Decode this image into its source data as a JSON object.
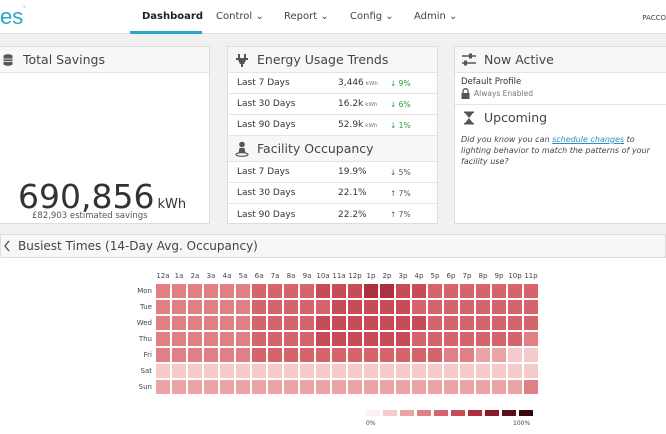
{
  "nav": {
    "logo": "es",
    "logo_mark": "°",
    "items": [
      {
        "label": "Dashboard",
        "active": true
      },
      {
        "label": "Control ⌄"
      },
      {
        "label": "Report ⌄"
      },
      {
        "label": "Config ⌄"
      },
      {
        "label": "Admin ⌄"
      }
    ],
    "user": "PACCO"
  },
  "savings": {
    "title": "Total Savings",
    "value": "690,856",
    "unit": "kWh",
    "subtext": "£82,903 estimated savings"
  },
  "energy": {
    "title": "Energy Usage Trends",
    "rows": [
      {
        "label": "Last 7 Days",
        "value": "3,446",
        "unit": "kWh",
        "change": "↓ 9%"
      },
      {
        "label": "Last 30 Days",
        "value": "16.2k",
        "unit": "kWh",
        "change": "↓ 6%"
      },
      {
        "label": "Last 90 Days",
        "value": "52.9k",
        "unit": "kWh",
        "change": "↓ 1%"
      }
    ]
  },
  "occupancy": {
    "title": "Facility Occupancy",
    "rows": [
      {
        "label": "Last 7 Days",
        "value": "19.9%",
        "change": "↓ 5%"
      },
      {
        "label": "Last 30 Days",
        "value": "22.1%",
        "change": "↑ 7%"
      },
      {
        "label": "Last 90 Days",
        "value": "22.2%",
        "change": "↑ 7%"
      }
    ]
  },
  "now_active": {
    "title": "Now Active",
    "profile": "Default Profile",
    "status": "Always Enabled"
  },
  "upcoming": {
    "title": "Upcoming",
    "tip_before": "Did you know you can ",
    "tip_link": "schedule changes",
    "tip_after": " to lighting behavior to match the patterns of your facility use?"
  },
  "busiest": {
    "title": "Busiest Times (14-Day Avg. Occupancy)",
    "hours": [
      "12a",
      "1a",
      "2a",
      "3a",
      "4a",
      "5a",
      "6a",
      "7a",
      "8a",
      "9a",
      "10a",
      "11a",
      "12p",
      "1p",
      "2p",
      "3p",
      "4p",
      "5p",
      "6p",
      "7p",
      "8p",
      "9p",
      "10p",
      "11p"
    ],
    "days": [
      "Mon",
      "Tue",
      "Wed",
      "Thu",
      "Fri",
      "Sat",
      "Sun"
    ],
    "levels": [
      [
        3,
        3,
        3,
        3,
        3,
        3,
        4,
        4,
        4,
        4,
        5,
        5,
        5,
        6,
        6,
        5,
        5,
        4,
        4,
        4,
        4,
        4,
        4,
        4
      ],
      [
        3,
        3,
        3,
        3,
        3,
        3,
        4,
        4,
        4,
        4,
        4,
        5,
        5,
        5,
        5,
        5,
        4,
        4,
        4,
        4,
        4,
        4,
        4,
        4
      ],
      [
        3,
        3,
        3,
        3,
        3,
        3,
        4,
        4,
        4,
        4,
        5,
        5,
        5,
        5,
        5,
        5,
        5,
        4,
        4,
        4,
        4,
        4,
        4,
        4
      ],
      [
        3,
        3,
        3,
        3,
        3,
        3,
        4,
        4,
        4,
        4,
        5,
        5,
        5,
        5,
        5,
        5,
        4,
        4,
        4,
        4,
        4,
        4,
        4,
        3
      ],
      [
        3,
        3,
        3,
        3,
        3,
        3,
        4,
        4,
        4,
        4,
        4,
        4,
        4,
        4,
        4,
        4,
        4,
        4,
        3,
        3,
        2,
        2,
        1,
        1
      ],
      [
        1,
        1,
        1,
        1,
        1,
        1,
        1,
        1,
        1,
        1,
        1,
        1,
        1,
        1,
        1,
        1,
        1,
        1,
        1,
        1,
        1,
        1,
        1,
        1
      ],
      [
        2,
        2,
        2,
        2,
        2,
        2,
        2,
        2,
        2,
        2,
        2,
        2,
        2,
        2,
        2,
        2,
        2,
        2,
        2,
        2,
        2,
        2,
        2,
        3
      ]
    ],
    "legend_colors": [
      "#fdf2f2",
      "#f4caca",
      "#eaa4a6",
      "#e08084",
      "#d6646a",
      "#c94b55",
      "#b02f3e",
      "#8a1a2a",
      "#5e0d1a",
      "#3a060e"
    ],
    "legend_min": "0%",
    "legend_max": "100%"
  }
}
